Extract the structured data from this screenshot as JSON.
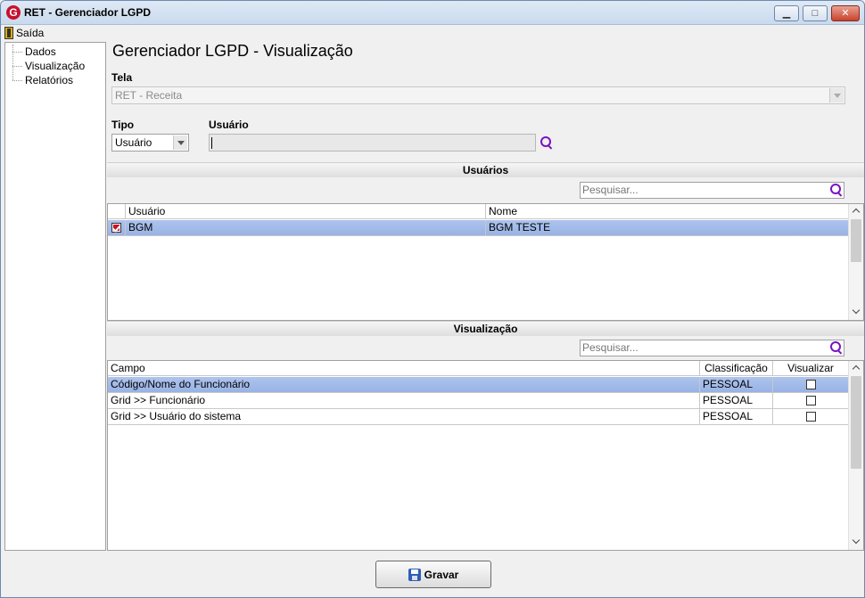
{
  "window": {
    "title": "RET - Gerenciador LGPD",
    "logo_letter": "G",
    "minimize_glyph": "▁",
    "maximize_glyph": "□",
    "close_glyph": "✕"
  },
  "menu": {
    "exit_label": "Saída"
  },
  "sidebar": {
    "items": [
      {
        "label": "Dados"
      },
      {
        "label": "Visualização"
      },
      {
        "label": "Relatórios"
      }
    ]
  },
  "main": {
    "title": "Gerenciador LGPD - Visualização",
    "tela_label": "Tela",
    "tela_value": "RET - Receita",
    "tipo_label": "Tipo",
    "tipo_value": "Usuário",
    "usuario_label": "Usuário",
    "usuario_value": ""
  },
  "usuarios_section": {
    "title": "Usuários",
    "search_placeholder": "Pesquisar...",
    "columns": [
      "Usuário",
      "Nome"
    ],
    "rows": [
      {
        "checked": true,
        "usuario": "BGM",
        "nome": "BGM TESTE"
      }
    ]
  },
  "visualizacao_section": {
    "title": "Visualização",
    "search_placeholder": "Pesquisar...",
    "columns": [
      "Campo",
      "Classificação",
      "Visualizar"
    ],
    "rows": [
      {
        "campo": "Código/Nome do Funcionário",
        "classificacao": "PESSOAL",
        "visualizar": false
      },
      {
        "campo": "Grid >> Funcionário",
        "classificacao": "PESSOAL",
        "visualizar": false
      },
      {
        "campo": "Grid >> Usuário do sistema",
        "classificacao": "PESSOAL",
        "visualizar": false
      }
    ]
  },
  "footer": {
    "save_label": "Gravar"
  },
  "colors": {
    "accent_search": "#7a12c4",
    "selected_row": "#a8bfeb"
  }
}
